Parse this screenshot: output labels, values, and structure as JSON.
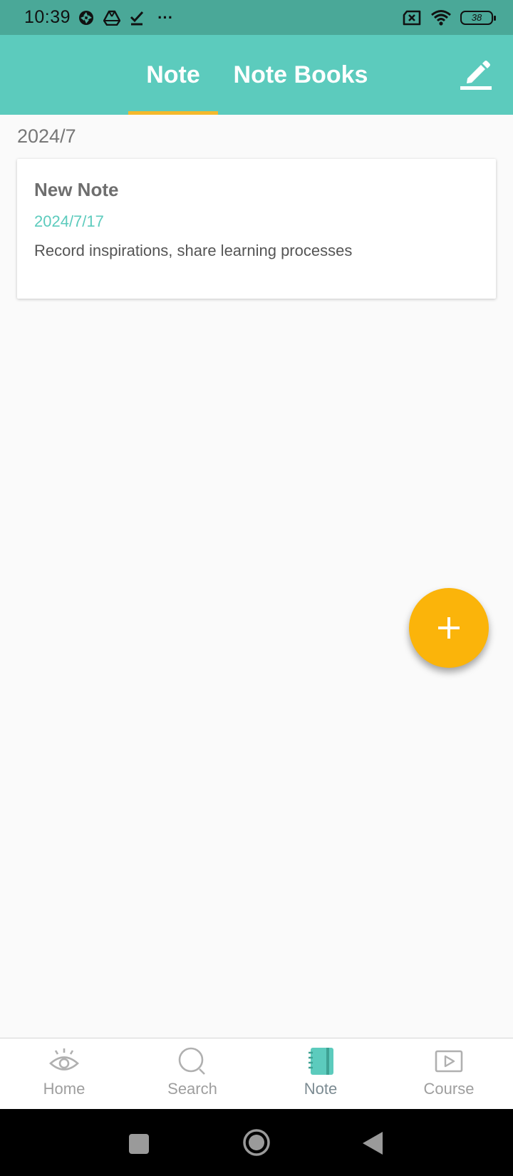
{
  "status_bar": {
    "time": "10:39",
    "more": "···",
    "battery": "38"
  },
  "app_bar": {
    "tabs": [
      {
        "label": "Note",
        "active": true
      },
      {
        "label": "Note Books",
        "active": false
      }
    ],
    "edit_icon": "pencil-icon"
  },
  "main": {
    "month": "2024/7",
    "notes": [
      {
        "title": "New Note",
        "date": "2024/7/17",
        "preview": "Record inspirations, share learning processes"
      }
    ],
    "fab_icon": "plus-icon"
  },
  "bottom_nav": {
    "items": [
      {
        "label": "Home",
        "icon": "eye-icon"
      },
      {
        "label": "Search",
        "icon": "search-icon"
      },
      {
        "label": "Note",
        "icon": "notebook-icon",
        "active": true
      },
      {
        "label": "Course",
        "icon": "play-icon"
      }
    ]
  },
  "colors": {
    "accent": "#5ccbbd",
    "status_bar": "#4aa898",
    "fab": "#fbb40a",
    "tab_indicator": "#f4b82c"
  }
}
